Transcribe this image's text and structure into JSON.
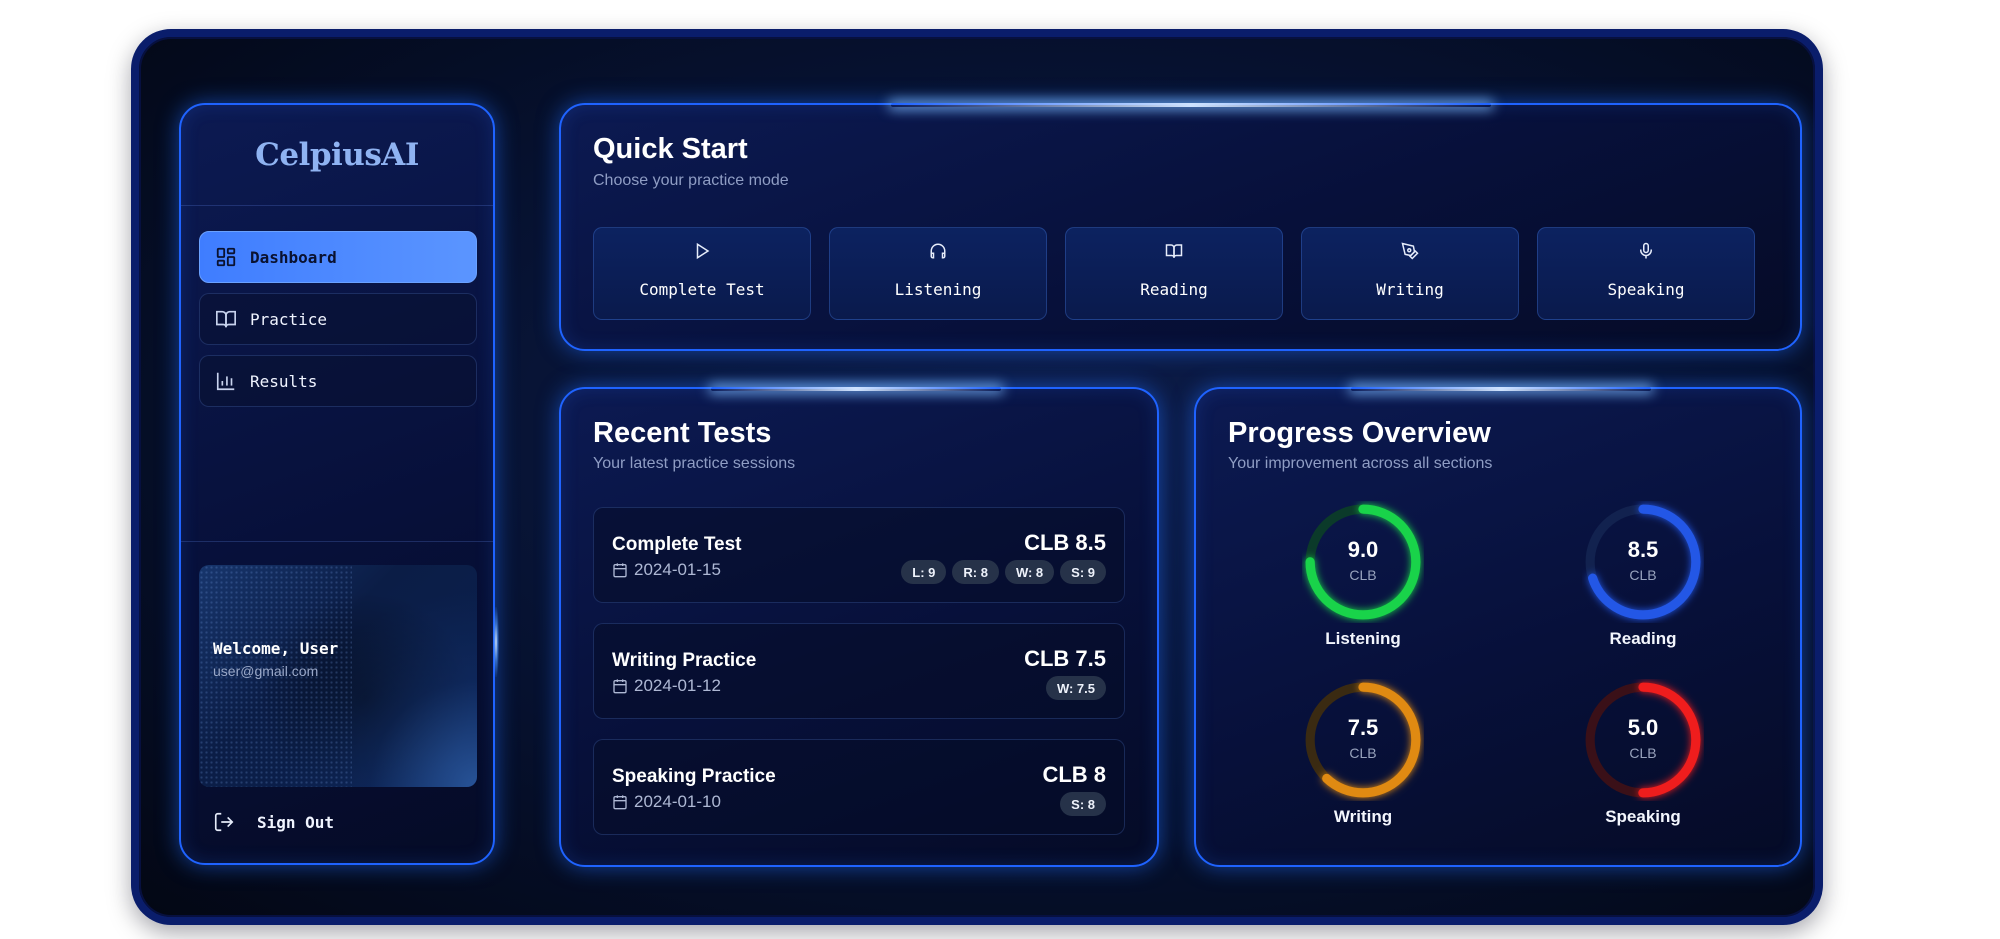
{
  "brand": {
    "logo_text": "CelpiusAI"
  },
  "sidebar": {
    "items": [
      {
        "label": "Dashboard",
        "icon": "grid-icon",
        "active": true
      },
      {
        "label": "Practice",
        "icon": "book-open-icon",
        "active": false
      },
      {
        "label": "Results",
        "icon": "bar-chart-icon",
        "active": false
      }
    ],
    "profile": {
      "welcome": "Welcome, User",
      "email": "user@gmail.com"
    },
    "sign_out_label": "Sign Out"
  },
  "quick_start": {
    "title": "Quick Start",
    "subtitle": "Choose your practice mode",
    "modes": [
      {
        "label": "Complete Test",
        "icon": "play-icon"
      },
      {
        "label": "Listening",
        "icon": "headphones-icon"
      },
      {
        "label": "Reading",
        "icon": "book-open-icon"
      },
      {
        "label": "Writing",
        "icon": "pen-tool-icon"
      },
      {
        "label": "Speaking",
        "icon": "microphone-icon"
      }
    ]
  },
  "recent_tests": {
    "title": "Recent Tests",
    "subtitle": "Your latest practice sessions",
    "tests": [
      {
        "name": "Complete Test",
        "date": "2024-01-15",
        "score": "CLB 8.5",
        "badges": [
          "L: 9",
          "R: 8",
          "W: 8",
          "S: 9"
        ]
      },
      {
        "name": "Writing Practice",
        "date": "2024-01-12",
        "score": "CLB 7.5",
        "badges": [
          "W: 7.5"
        ]
      },
      {
        "name": "Speaking Practice",
        "date": "2024-01-10",
        "score": "CLB 8",
        "badges": [
          "S: 8"
        ]
      }
    ]
  },
  "progress_overview": {
    "title": "Progress Overview",
    "subtitle": "Your improvement across all sections",
    "unit": "CLB",
    "sections": [
      {
        "name": "Listening",
        "value": "9.0",
        "fraction": 0.75,
        "color": "#19d34a",
        "track": "#0b3a2a"
      },
      {
        "name": "Reading",
        "value": "8.5",
        "fraction": 0.7,
        "color": "#2357e6",
        "track": "#12224f"
      },
      {
        "name": "Writing",
        "value": "7.5",
        "fraction": 0.62,
        "color": "#e08a12",
        "track": "#3a2a12"
      },
      {
        "name": "Speaking",
        "value": "5.0",
        "fraction": 0.5,
        "color": "#ef1d1d",
        "track": "#3a1018"
      }
    ]
  }
}
